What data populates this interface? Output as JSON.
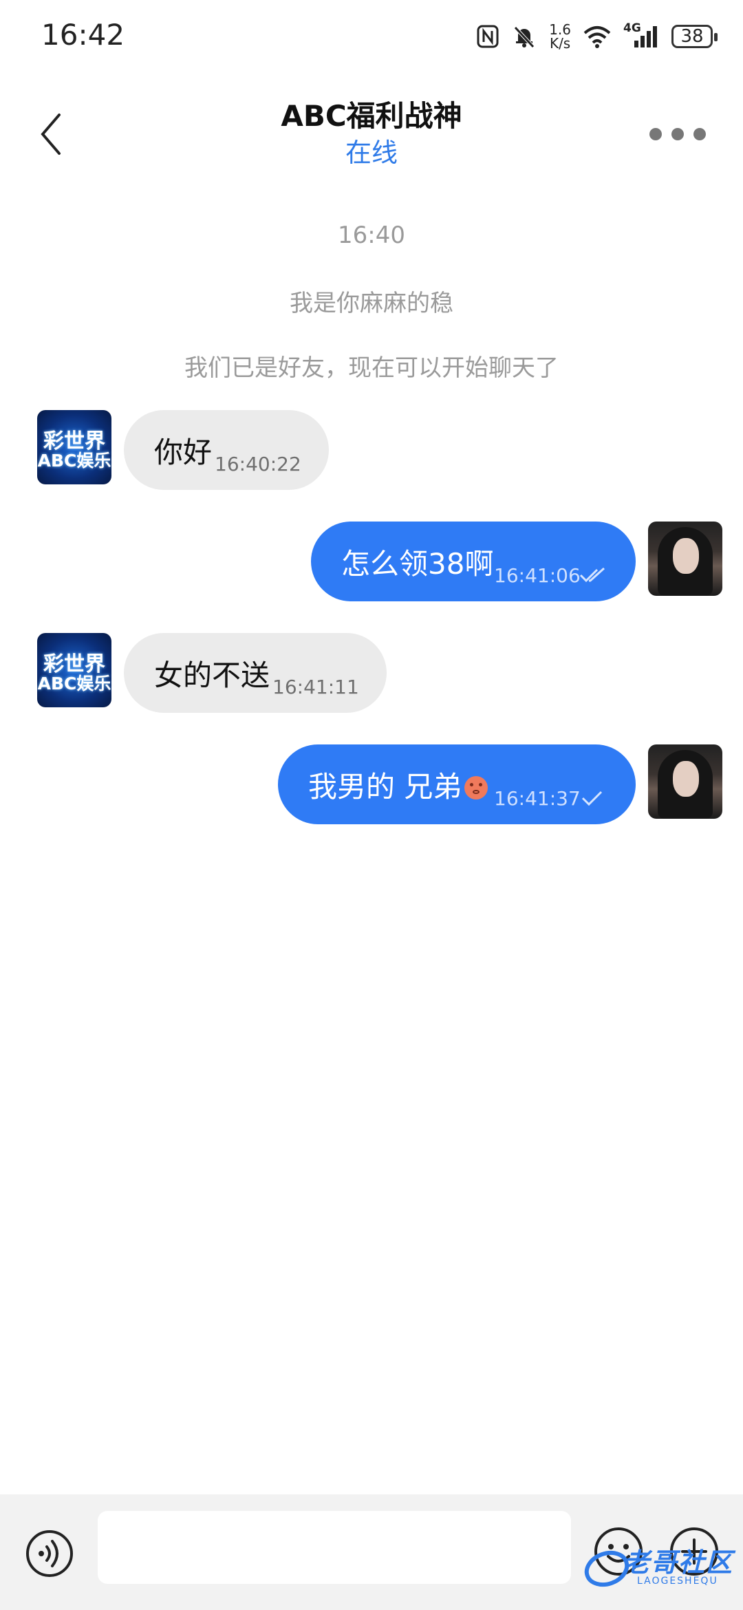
{
  "status_bar": {
    "time": "16:42",
    "net_speed_value": "1.6",
    "net_speed_unit": "K/s",
    "network": "4G",
    "battery": "38"
  },
  "header": {
    "title": "ABC福利战神",
    "status": "在线"
  },
  "system_messages": [
    "16:40",
    "我是你麻麻的稳",
    "我们已是好友，现在可以开始聊天了"
  ],
  "contact_avatar": {
    "line1": "彩世界",
    "line2": "ABC娱乐"
  },
  "messages": [
    {
      "direction": "incoming",
      "text": "你好",
      "time": "16:40:22"
    },
    {
      "direction": "outgoing",
      "text": "怎么领38啊",
      "time": "16:41:06",
      "status": "read"
    },
    {
      "direction": "incoming",
      "text": "女的不送",
      "time": "16:41:11"
    },
    {
      "direction": "outgoing",
      "text": "我男的 兄弟",
      "time": "16:41:37",
      "status": "sent",
      "emoji": "flushed-face"
    }
  ],
  "input": {
    "placeholder": ""
  },
  "watermark": {
    "text": "老哥社区",
    "sub": "LAOGESHEQU"
  },
  "colors": {
    "accent": "#2f7bf5",
    "incoming_bubble": "#ebebeb",
    "system_text": "#9a9a9a"
  }
}
